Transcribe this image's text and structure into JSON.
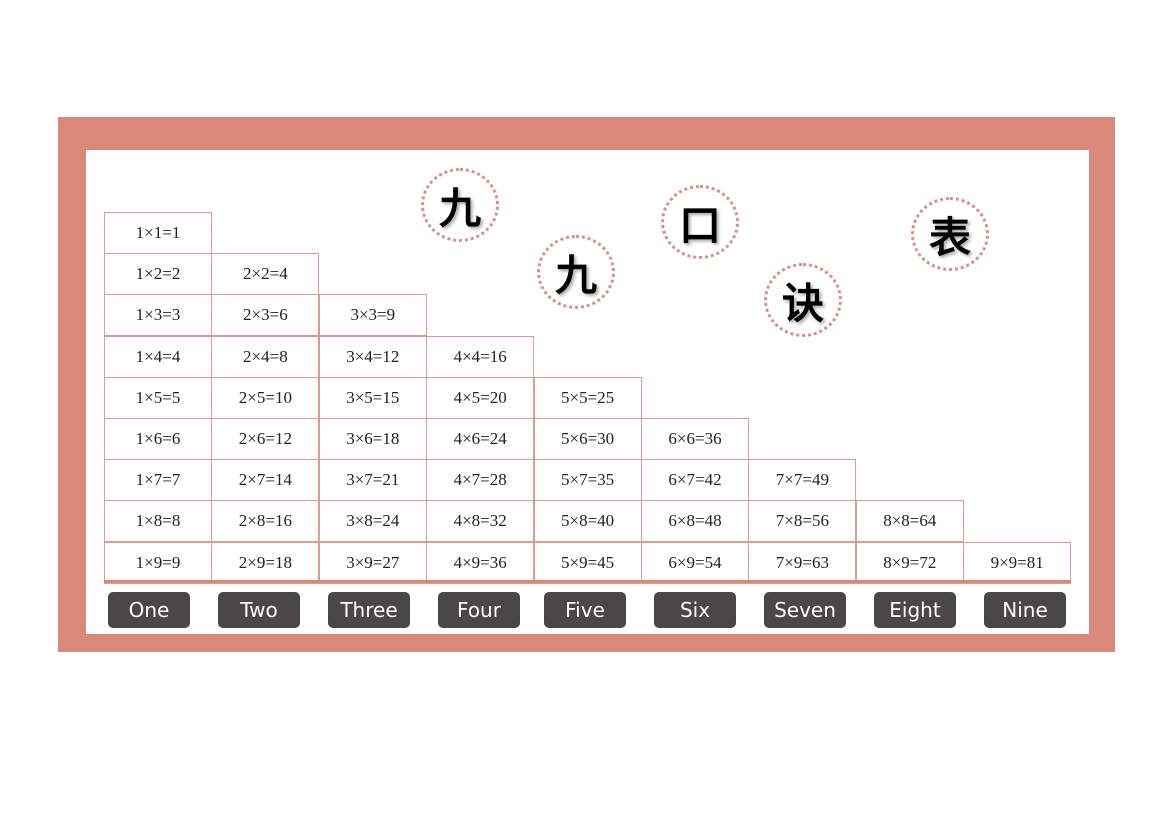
{
  "colors": {
    "frame": "#D9897A",
    "cell_border": "#E19A8E",
    "button_bg": "#4A4846",
    "button_text": "#FFFFFF",
    "circle_dots": "#DE8F82"
  },
  "title_chars": [
    "九",
    "九",
    "口",
    "诀",
    "表"
  ],
  "table": {
    "rows": [
      [
        "1×1=1"
      ],
      [
        "1×2=2",
        "2×2=4"
      ],
      [
        "1×3=3",
        "2×3=6",
        "3×3=9"
      ],
      [
        "1×4=4",
        "2×4=8",
        "3×4=12",
        "4×4=16"
      ],
      [
        "1×5=5",
        "2×5=10",
        "3×5=15",
        "4×5=20",
        "5×5=25"
      ],
      [
        "1×6=6",
        "2×6=12",
        "3×6=18",
        "4×6=24",
        "5×6=30",
        "6×6=36"
      ],
      [
        "1×7=7",
        "2×7=14",
        "3×7=21",
        "4×7=28",
        "5×7=35",
        "6×7=42",
        "7×7=49"
      ],
      [
        "1×8=8",
        "2×8=16",
        "3×8=24",
        "4×8=32",
        "5×8=40",
        "6×8=48",
        "7×8=56",
        "8×8=64"
      ],
      [
        "1×9=9",
        "2×9=18",
        "3×9=27",
        "4×9=36",
        "5×9=45",
        "6×9=54",
        "7×9=63",
        "8×9=72",
        "9×9=81"
      ]
    ]
  },
  "buttons": [
    "One",
    "Two",
    "Three",
    "Four",
    "Five",
    "Six",
    "Seven",
    "Eight",
    "Nine"
  ]
}
